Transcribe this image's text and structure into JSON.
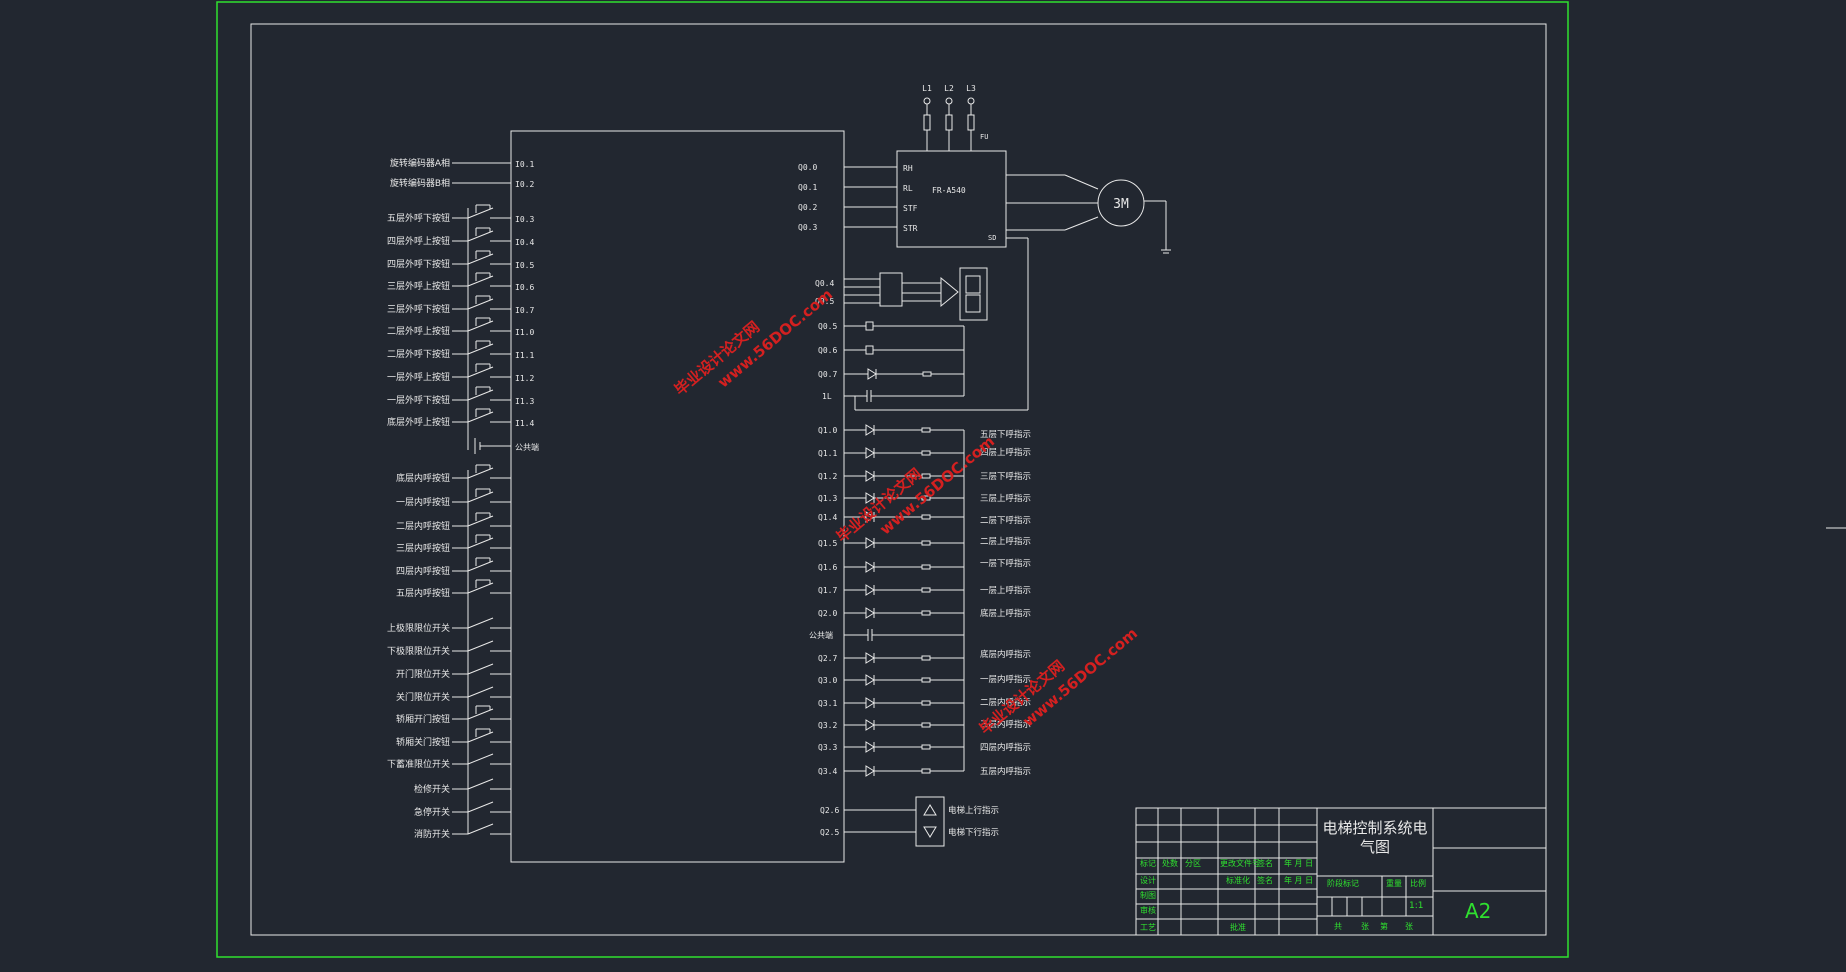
{
  "colors": {
    "background": "#222730",
    "line": "#e8e8e8",
    "frame": "#2fe02f",
    "watermark": "#d42020"
  },
  "left_inputs": [
    {
      "label": "旋转编码器A相",
      "io": "I0.1",
      "kind": "plain"
    },
    {
      "label": "旋转编码器B相",
      "io": "I0.2",
      "kind": "plain"
    },
    {
      "label": "五层外呼下按钮",
      "io": "I0.3",
      "kind": "button"
    },
    {
      "label": "四层外呼上按钮",
      "io": "I0.4",
      "kind": "button"
    },
    {
      "label": "四层外呼下按钮",
      "io": "I0.5",
      "kind": "button"
    },
    {
      "label": "三层外呼上按钮",
      "io": "I0.6",
      "kind": "button"
    },
    {
      "label": "三层外呼下按钮",
      "io": "I0.7",
      "kind": "button"
    },
    {
      "label": "二层外呼上按钮",
      "io": "I1.0",
      "kind": "button"
    },
    {
      "label": "二层外呼下按钮",
      "io": "I1.1",
      "kind": "button"
    },
    {
      "label": "一层外呼上按钮",
      "io": "I1.2",
      "kind": "button"
    },
    {
      "label": "一层外呼下按钮",
      "io": "I1.3",
      "kind": "button"
    },
    {
      "label": "底层外呼上按钮",
      "io": "I1.4",
      "kind": "button"
    },
    {
      "label": "",
      "io": "公共端",
      "kind": "common"
    },
    {
      "label": "底层内呼按钮",
      "io": "",
      "kind": "button"
    },
    {
      "label": "一层内呼按钮",
      "io": "",
      "kind": "button"
    },
    {
      "label": "二层内呼按钮",
      "io": "",
      "kind": "button"
    },
    {
      "label": "三层内呼按钮",
      "io": "",
      "kind": "button"
    },
    {
      "label": "四层内呼按钮",
      "io": "",
      "kind": "button"
    },
    {
      "label": "五层内呼按钮",
      "io": "",
      "kind": "button"
    },
    {
      "label": "上极限限位开关",
      "io": "",
      "kind": "switch"
    },
    {
      "label": "下极限限位开关",
      "io": "",
      "kind": "switch"
    },
    {
      "label": "开门限位开关",
      "io": "",
      "kind": "switch"
    },
    {
      "label": "关门限位开关",
      "io": "",
      "kind": "switch"
    },
    {
      "label": "轿厢开门按钮",
      "io": "",
      "kind": "button"
    },
    {
      "label": "轿厢关门按钮",
      "io": "",
      "kind": "button"
    },
    {
      "label": "下蓄准限位开关",
      "io": "",
      "kind": "switch"
    },
    {
      "label": "检修开关",
      "io": "",
      "kind": "switch"
    },
    {
      "label": "急停开关",
      "io": "",
      "kind": "switch"
    },
    {
      "label": "消防开关",
      "io": "",
      "kind": "switch"
    }
  ],
  "drive_outputs": [
    "Q0.0",
    "Q0.1",
    "Q0.2",
    "Q0.3"
  ],
  "inverter": {
    "model": "FR-A540",
    "terminals": [
      "RH",
      "RL",
      "STF",
      "STR"
    ],
    "sd": "SD",
    "fuse": "FU",
    "phases": [
      "L1",
      "L2",
      "L3"
    ],
    "motor": "3M"
  },
  "display_outputs": [
    "Q0.4",
    "Q0.5"
  ],
  "misc_outputs": [
    "Q0.5",
    "Q0.6",
    "Q0.7",
    "1L"
  ],
  "lamp_outputs": [
    {
      "io": "Q1.0",
      "label": "五层下呼指示"
    },
    {
      "io": "Q1.1",
      "label": "四层上呼指示"
    },
    {
      "io": "Q1.2",
      "label": "三层下呼指示"
    },
    {
      "io": "Q1.3",
      "label": "三层上呼指示"
    },
    {
      "io": "Q1.4",
      "label": "二层下呼指示"
    },
    {
      "io": "Q1.5",
      "label": "二层上呼指示"
    },
    {
      "io": "Q1.6",
      "label": "一层下呼指示"
    },
    {
      "io": "Q1.7",
      "label": "一层上呼指示"
    },
    {
      "io": "Q2.0",
      "label": "底层上呼指示"
    },
    {
      "io": "公共端",
      "label": ""
    },
    {
      "io": "Q2.7",
      "label": "底层内呼指示"
    },
    {
      "io": "Q3.0",
      "label": "一层内呼指示"
    },
    {
      "io": "Q3.1",
      "label": "二层内呼指示"
    },
    {
      "io": "Q3.2",
      "label": "三层内呼指示"
    },
    {
      "io": "Q3.3",
      "label": "四层内呼指示"
    },
    {
      "io": "Q3.4",
      "label": "五层内呼指示"
    }
  ],
  "direction_outputs": [
    {
      "io": "Q2.6",
      "label": "电梯上行指示"
    },
    {
      "io": "Q2.5",
      "label": "电梯下行指示"
    }
  ],
  "title_block": {
    "title": "电梯控制系统电气图",
    "row1": [
      "标记",
      "处数",
      "分区",
      "更改文件号",
      "签名",
      "年 月 日"
    ],
    "row2": [
      "设计",
      "",
      "标准化",
      "签名",
      "年 月 日"
    ],
    "left_col": [
      "制图",
      "审核",
      "工艺"
    ],
    "approve": "批准",
    "stage_mark": "阶段标记",
    "weight": "重量",
    "scale_label": "比例",
    "scale": "1:1",
    "sheets": [
      "共",
      "张",
      "第",
      "张"
    ],
    "size": "A2"
  },
  "watermarks": [
    {
      "line1": "毕业设计论文网",
      "line2": "www.56DOC.com"
    },
    {
      "line1": "毕业设计论文网",
      "line2": "www.56DOC.com"
    },
    {
      "line1": "毕业设计论文网",
      "line2": "www.56DOC.com"
    }
  ]
}
